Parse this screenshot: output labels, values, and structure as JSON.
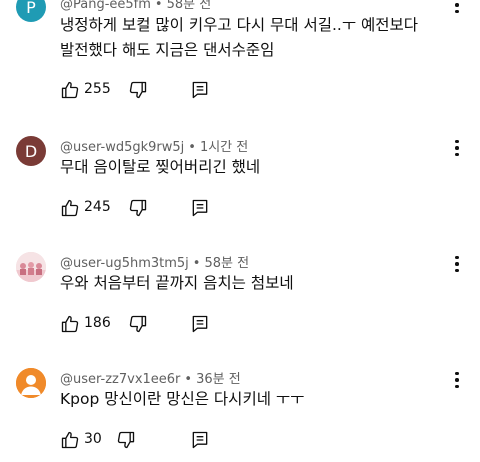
{
  "comments": [
    {
      "username": "@Pang-ee5fm",
      "time": "58분 전",
      "avatar_letter": "P",
      "avatar_color": "#1f9bb4",
      "lines": [
        "냉정하게 보컬 많이 키우고 다시 무대 서길..ㅜ 예전보다",
        "발전했다 해도 지금은 댄서수준임"
      ],
      "likes": "255"
    },
    {
      "username": "@user-wd5gk9rw5j",
      "time": "1시간 전",
      "avatar_letter": "D",
      "avatar_color": "#7a3b36",
      "lines": [
        "무대 음이탈로 찢어버리긴 했네"
      ],
      "likes": "245"
    },
    {
      "username": "@user-ug5hm3tm5j",
      "time": "58분 전",
      "avatar_letter": "",
      "avatar_color": "#f3d6da",
      "lines": [
        "우와 처음부터 끝까지 음치는 첨보네"
      ],
      "likes": "186"
    },
    {
      "username": "@user-zz7vx1ee6r",
      "time": "36분 전",
      "avatar_letter": "",
      "avatar_color": "#f08a2a",
      "lines": [
        "Kpop 망신이란 망신은 다시키네 ㅜㅜ"
      ],
      "likes": "30"
    }
  ],
  "icons": {
    "like": "thumbs-up-icon",
    "dislike": "thumbs-down-icon",
    "reply": "reply-icon",
    "menu": "more-vert-icon"
  },
  "separator": "•"
}
